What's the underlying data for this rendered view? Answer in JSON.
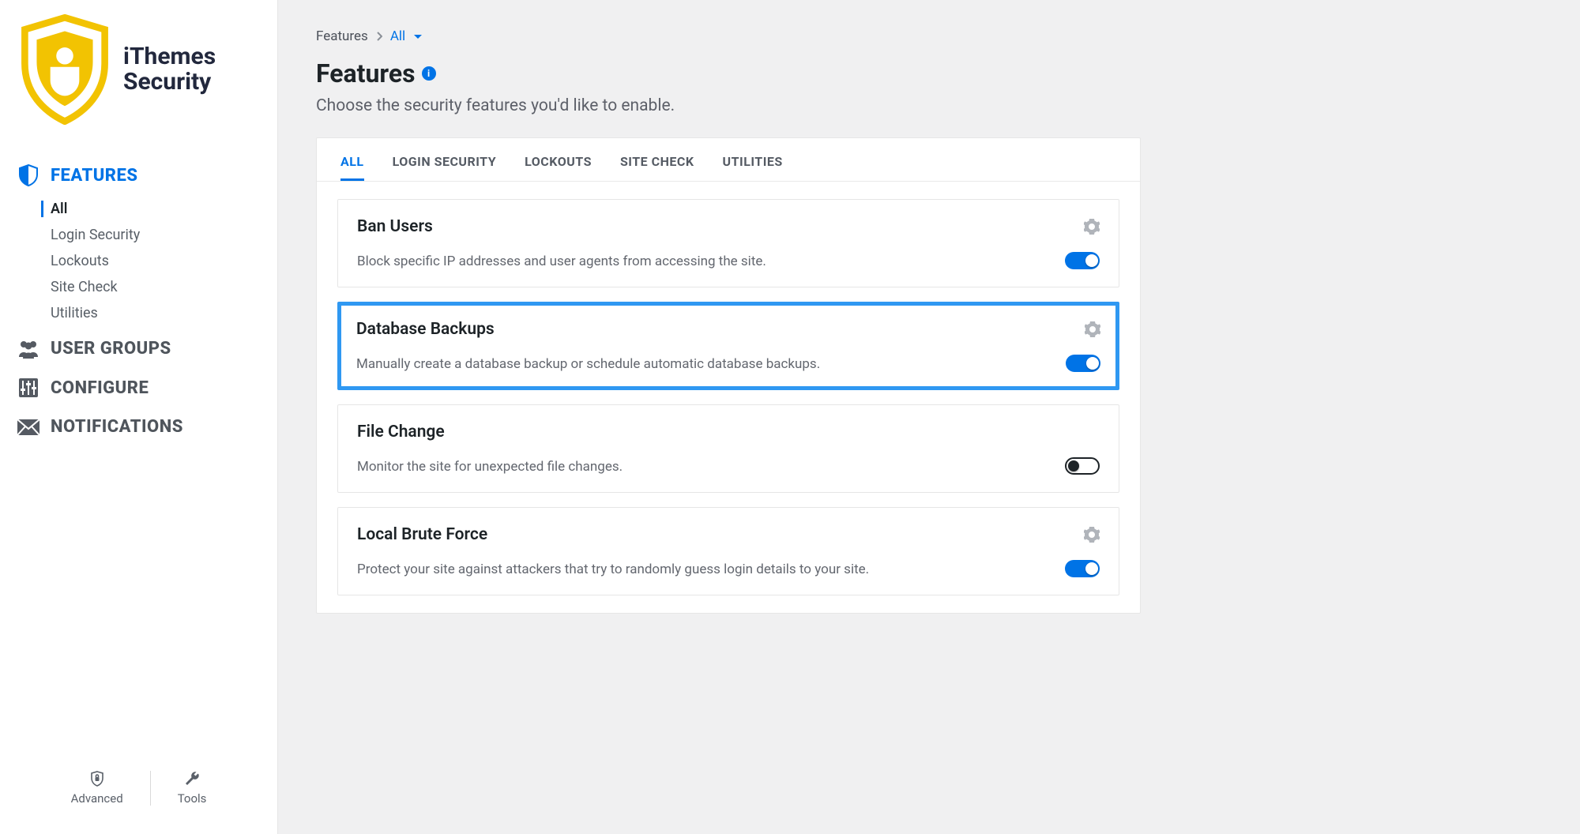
{
  "brand": {
    "line1": "iThemes",
    "line2": "Security"
  },
  "sidebar": {
    "items": [
      {
        "id": "features",
        "label": "FEATURES",
        "active": true
      },
      {
        "id": "user-groups",
        "label": "USER GROUPS"
      },
      {
        "id": "configure",
        "label": "CONFIGURE"
      },
      {
        "id": "notifications",
        "label": "NOTIFICATIONS"
      }
    ],
    "sub_features": [
      {
        "id": "all",
        "label": "All",
        "active": true
      },
      {
        "id": "login-security",
        "label": "Login Security"
      },
      {
        "id": "lockouts",
        "label": "Lockouts"
      },
      {
        "id": "site-check",
        "label": "Site Check"
      },
      {
        "id": "utilities",
        "label": "Utilities"
      }
    ],
    "footer": {
      "advanced": "Advanced",
      "tools": "Tools"
    }
  },
  "breadcrumb": {
    "root": "Features",
    "current": "All"
  },
  "page": {
    "title": "Features",
    "subtitle": "Choose the security features you'd like to enable."
  },
  "tabs": [
    {
      "id": "all",
      "label": "ALL",
      "active": true
    },
    {
      "id": "login-security",
      "label": "LOGIN SECURITY"
    },
    {
      "id": "lockouts",
      "label": "LOCKOUTS"
    },
    {
      "id": "site-check",
      "label": "SITE CHECK"
    },
    {
      "id": "utilities",
      "label": "UTILITIES"
    }
  ],
  "features": [
    {
      "id": "ban-users",
      "title": "Ban Users",
      "desc": "Block specific IP addresses and user agents from accessing the site.",
      "enabled": true,
      "highlight": false
    },
    {
      "id": "database-backups",
      "title": "Database Backups",
      "desc": "Manually create a database backup or schedule automatic database backups.",
      "enabled": true,
      "highlight": true
    },
    {
      "id": "file-change",
      "title": "File Change",
      "desc": "Monitor the site for unexpected file changes.",
      "enabled": false,
      "highlight": false
    },
    {
      "id": "local-brute-force",
      "title": "Local Brute Force",
      "desc": "Protect your site against attackers that try to randomly guess login details to your site.",
      "enabled": true,
      "highlight": false
    }
  ],
  "colors": {
    "accent": "#0073e6",
    "brandYellow": "#f2c302"
  }
}
